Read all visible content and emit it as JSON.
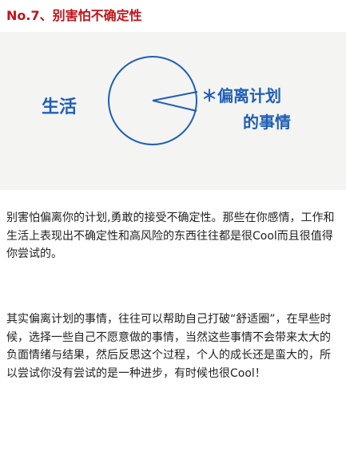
{
  "article": {
    "heading": "No.7、别害怕不确定性",
    "sketch": {
      "left_label": "生活",
      "right_label_line1": "＊偏离计划",
      "right_label_line2": "的事情",
      "ink_color": "#1f5fb8"
    },
    "paragraphs": [
      "别害怕偏离你的计划,勇敢的接受不确定性。那些在你感情，工作和生活上表现出不确定性和高风险的东西往往都是很Cool而且很值得你尝试的。",
      "其实偏离计划的事情，往往可以帮助自己打破“舒适圈”，在早些时候，选择一些自己不愿意做的事情，当然这些事情不会带来太大的负面情绪与结果，然后反思这个过程，个人的成长还是蛮大的，所以尝试你没有尝试的是一种进步，有时候也很Cool！"
    ],
    "heading_color": "#c0151b"
  }
}
